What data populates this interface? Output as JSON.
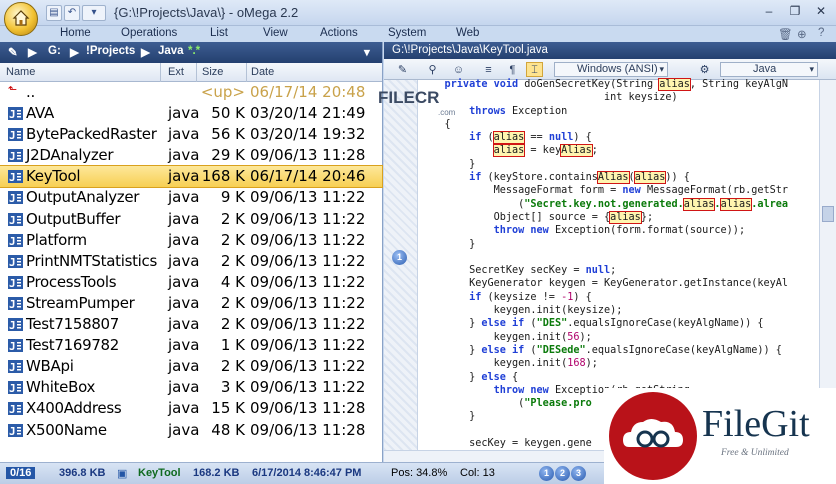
{
  "window": {
    "title": "{G:\\!Projects\\Java\\} - oMega 2.2",
    "minimize": "–",
    "restore": "❐",
    "close": "✕"
  },
  "ribbon": {
    "tabs": [
      "Home",
      "Operations",
      "List",
      "View",
      "Actions",
      "System",
      "Web"
    ]
  },
  "left_pane": {
    "path": {
      "drive": "G:",
      "folder": "!Projects",
      "sub": "Java",
      "filter": "*.*"
    },
    "columns": {
      "name": "Name",
      "ext": "Ext",
      "size": "Size",
      "date": "Date"
    },
    "rows": [
      {
        "name": "..",
        "ext": "",
        "size": "<up>",
        "date": "06/17/14",
        "time": "20:48",
        "up": true
      },
      {
        "name": "AVA",
        "ext": "java",
        "size": "50 K",
        "date": "03/20/14",
        "time": "21:49"
      },
      {
        "name": "BytePackedRaster",
        "ext": "java",
        "size": "56 K",
        "date": "03/20/14",
        "time": "19:32"
      },
      {
        "name": "J2DAnalyzer",
        "ext": "java",
        "size": "29 K",
        "date": "09/06/13",
        "time": "11:28"
      },
      {
        "name": "KeyTool",
        "ext": "java",
        "size": "168 K",
        "date": "06/17/14",
        "time": "20:46",
        "selected": true
      },
      {
        "name": "OutputAnalyzer",
        "ext": "java",
        "size": "9 K",
        "date": "09/06/13",
        "time": "11:22"
      },
      {
        "name": "OutputBuffer",
        "ext": "java",
        "size": "2 K",
        "date": "09/06/13",
        "time": "11:22"
      },
      {
        "name": "Platform",
        "ext": "java",
        "size": "2 K",
        "date": "09/06/13",
        "time": "11:22"
      },
      {
        "name": "PrintNMTStatistics",
        "ext": "java",
        "size": "2 K",
        "date": "09/06/13",
        "time": "11:22"
      },
      {
        "name": "ProcessTools",
        "ext": "java",
        "size": "4 K",
        "date": "09/06/13",
        "time": "11:22"
      },
      {
        "name": "StreamPumper",
        "ext": "java",
        "size": "2 K",
        "date": "09/06/13",
        "time": "11:22"
      },
      {
        "name": "Test7158807",
        "ext": "java",
        "size": "2 K",
        "date": "09/06/13",
        "time": "11:22"
      },
      {
        "name": "Test7169782",
        "ext": "java",
        "size": "1 K",
        "date": "09/06/13",
        "time": "11:22"
      },
      {
        "name": "WBApi",
        "ext": "java",
        "size": "2 K",
        "date": "09/06/13",
        "time": "11:22"
      },
      {
        "name": "WhiteBox",
        "ext": "java",
        "size": "3 K",
        "date": "09/06/13",
        "time": "11:22"
      },
      {
        "name": "X400Address",
        "ext": "java",
        "size": "15 K",
        "date": "09/06/13",
        "time": "11:28"
      },
      {
        "name": "X500Name",
        "ext": "java",
        "size": "48 K",
        "date": "09/06/13",
        "time": "11:28"
      }
    ]
  },
  "right_pane": {
    "path": "G:\\!Projects\\Java\\KeyTool.java",
    "encoding": "Windows (ANSI)",
    "syntax": "Java",
    "bookmark": "1"
  },
  "code_lines": [
    [
      [
        "kw",
        "    private void "
      ],
      [
        "",
        "doGenSecretKey(String "
      ],
      [
        "hl",
        "alias"
      ],
      [
        "",
        ", String keyAlgN"
      ]
    ],
    [
      [
        "",
        "                              int keysize)"
      ]
    ],
    [
      [
        "kw",
        "        throws "
      ],
      [
        "",
        "Exception"
      ]
    ],
    [
      [
        "",
        "    {"
      ]
    ],
    [
      [
        "kw",
        "        if "
      ],
      [
        "",
        "("
      ],
      [
        "hl",
        "alias"
      ],
      [
        "",
        " == "
      ],
      [
        "kw",
        "null"
      ],
      [
        "",
        ") {"
      ]
    ],
    [
      [
        "",
        "            "
      ],
      [
        "hl",
        "alias"
      ],
      [
        "",
        " = key"
      ],
      [
        "hl",
        "Alias"
      ],
      [
        "",
        ";"
      ]
    ],
    [
      [
        "",
        "        }"
      ]
    ],
    [
      [
        "kw",
        "        if "
      ],
      [
        "",
        "(keyStore.contains"
      ],
      [
        "hl",
        "Alias"
      ],
      [
        "",
        "("
      ],
      [
        "hl",
        "alias"
      ],
      [
        "",
        ")) {"
      ]
    ],
    [
      [
        "",
        "            MessageFormat form = "
      ],
      [
        "kw",
        "new "
      ],
      [
        "",
        "MessageFormat(rb.getStr"
      ]
    ],
    [
      [
        "",
        "                ("
      ],
      [
        "str",
        "\"Secret.key.not.generated."
      ],
      [
        "hl",
        "alias"
      ],
      [
        "str",
        "."
      ],
      [
        "hl",
        "alias"
      ],
      [
        "str",
        ".alrea"
      ]
    ],
    [
      [
        "",
        "            Object[] source = {"
      ],
      [
        "hl",
        "alias"
      ],
      [
        "",
        "};"
      ]
    ],
    [
      [
        "kw",
        "            throw new "
      ],
      [
        "",
        "Exception(form.format(source));"
      ]
    ],
    [
      [
        "",
        "        }"
      ]
    ],
    [
      [
        "",
        ""
      ]
    ],
    [
      [
        "",
        "        SecretKey secKey = "
      ],
      [
        "kw",
        "null"
      ],
      [
        "",
        ";"
      ]
    ],
    [
      [
        "",
        "        KeyGenerator keygen = KeyGenerator.getInstance(keyAl"
      ]
    ],
    [
      [
        "kw",
        "        if "
      ],
      [
        "",
        "(keysize != "
      ],
      [
        "num",
        "-1"
      ],
      [
        "",
        ") {"
      ]
    ],
    [
      [
        "",
        "            keygen.init(keysize);"
      ]
    ],
    [
      [
        "",
        "        } "
      ],
      [
        "kw",
        "else if "
      ],
      [
        "",
        "("
      ],
      [
        "str",
        "\"DES\""
      ],
      [
        "",
        ".equalsIgnoreCase(keyAlgName)) {"
      ]
    ],
    [
      [
        "",
        "            keygen.init("
      ],
      [
        "num",
        "56"
      ],
      [
        "",
        ");"
      ]
    ],
    [
      [
        "",
        "        } "
      ],
      [
        "kw",
        "else if "
      ],
      [
        "",
        "("
      ],
      [
        "str",
        "\"DESede\""
      ],
      [
        "",
        ".equalsIgnoreCase(keyAlgName)) {"
      ]
    ],
    [
      [
        "",
        "            keygen.init("
      ],
      [
        "num",
        "168"
      ],
      [
        "",
        ");"
      ]
    ],
    [
      [
        "",
        "        } "
      ],
      [
        "kw",
        "else "
      ],
      [
        "",
        "{"
      ]
    ],
    [
      [
        "kw",
        "            throw new "
      ],
      [
        "",
        "Exception(rb.getString"
      ]
    ],
    [
      [
        "",
        "                ("
      ],
      [
        "str",
        "\"Please.pro"
      ]
    ],
    [
      [
        "",
        "        }"
      ]
    ],
    [
      [
        "",
        ""
      ]
    ],
    [
      [
        "",
        "        secKey = keygen.gene"
      ]
    ]
  ],
  "status": {
    "count": "0/16",
    "selected_size": "396.8 KB",
    "current_file": "KeyTool",
    "current_size": "168.2 KB",
    "current_datetime": "6/17/2014 8:46:47 PM",
    "pos": "Pos: 34.8%",
    "col": "Col: 13",
    "bookmarks": [
      "1",
      "2",
      "3"
    ]
  },
  "watermarks": {
    "filecr": "FILECR",
    "filecr_sub": ".com",
    "filegit": "FileGit",
    "filegit_tag": "Free & Unlimited"
  }
}
